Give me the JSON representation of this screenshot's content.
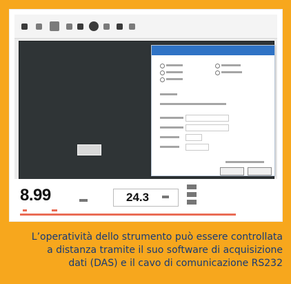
{
  "instrument": {
    "primary_value": "8.99",
    "secondary_value": "24.3"
  },
  "caption": "L’operatività dello strumento può essere controllata\na distanza tramite il suo software di acquisizione\ndati (DAS) e il cavo di comunicazione RS232",
  "icons": [
    "measurement-tool-icon",
    "chart-icon",
    "gear-icon",
    "record-icon",
    "info-icon",
    "window-icon"
  ],
  "colors": {
    "background": "#f7a71d",
    "graph_background": "#2f3436",
    "dialog_header": "#2f73c5",
    "caption_text": "#173a75",
    "red_status": "#e5472a"
  }
}
